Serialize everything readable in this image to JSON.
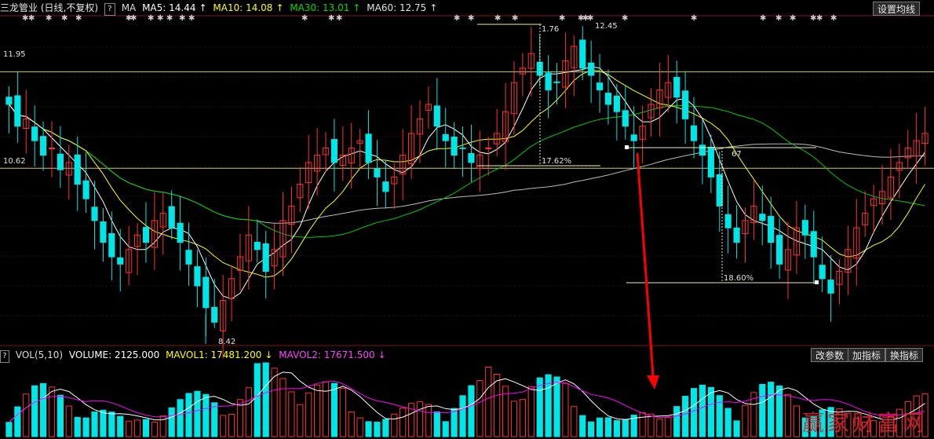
{
  "header": {
    "stock_name": "三龙管业",
    "period": "(日线,不复权)",
    "help_icon": "?",
    "ma_label": "MA",
    "ma5": "MA5: 14.44",
    "ma10": "MA10: 14.08",
    "ma30": "MA30: 13.01",
    "ma60": "MA60: 12.75",
    "arrow": "↑",
    "settings_button": "设置均线"
  },
  "volume_header": {
    "help_icon": "?",
    "vol": "VOL(5,10)",
    "volume": "VOLUME: 2125.000",
    "mavol1": "MAVOL1: 17481.200",
    "mavol2": "MAVOL2: 17671.500",
    "arrow": "↓",
    "buttons": [
      "改参数",
      "加指标",
      "换指标"
    ]
  },
  "price_labels": {
    "left_upper": "11.95",
    "left_lower": "10.62",
    "peak_high": "12.45",
    "peak_partial": "1.76",
    "low": "8.42",
    "mid_right": "67",
    "pct_1": "17.62%",
    "pct_2": "18.60%"
  },
  "watermark": "赢家财富网",
  "colors": {
    "background": "#000000",
    "up": "#ff3232",
    "down": "#00e5e5",
    "ma5": "#ffffff",
    "ma10": "#ffff00",
    "ma30": "#00cc00",
    "ma60": "#ffffff",
    "mavol2": "#ff00ff",
    "hline": "#cccc66",
    "arrow": "#ff0000"
  },
  "chart_data": {
    "type": "candlestick",
    "price_range": [
      8.42,
      12.45
    ],
    "closes": [
      11.5,
      11.2,
      11.3,
      11.0,
      10.8,
      10.9,
      10.6,
      10.7,
      10.4,
      10.2,
      9.9,
      9.6,
      9.4,
      9.3,
      9.5,
      9.7,
      9.6,
      9.9,
      10.0,
      9.8,
      9.6,
      9.3,
      9.0,
      8.7,
      8.5,
      8.8,
      9.1,
      9.4,
      9.7,
      9.5,
      9.2,
      9.5,
      9.9,
      10.1,
      10.4,
      10.7,
      10.8,
      10.9,
      10.7,
      10.8,
      10.9,
      11.0,
      10.7,
      10.5,
      10.3,
      10.5,
      10.8,
      11.1,
      11.3,
      11.5,
      11.2,
      11.0,
      10.8,
      10.9,
      10.7,
      10.8,
      10.9,
      11.1,
      11.4,
      11.8,
      12.0,
      12.2,
      11.9,
      11.7,
      11.8,
      12.1,
      12.3,
      12.0,
      11.9,
      11.7,
      11.5,
      11.4,
      11.2,
      11.0,
      11.2,
      11.5,
      11.7,
      11.8,
      11.6,
      11.3,
      11.0,
      10.8,
      10.5,
      10.1,
      9.8,
      9.6,
      9.9,
      10.1,
      9.9,
      9.6,
      9.3,
      9.5,
      9.8,
      9.7,
      9.4,
      9.1,
      8.9,
      9.2,
      9.5,
      9.8,
      10.0,
      10.2,
      10.3,
      10.5,
      10.7,
      10.9,
      11.0,
      11.1
    ],
    "ma_values": {
      "MA5": 14.44,
      "MA10": 14.08,
      "MA30": 13.01,
      "MA60": 12.75
    },
    "volume": {
      "current": 2125.0,
      "mavol1": 17481.2,
      "mavol2": 17671.5
    }
  }
}
